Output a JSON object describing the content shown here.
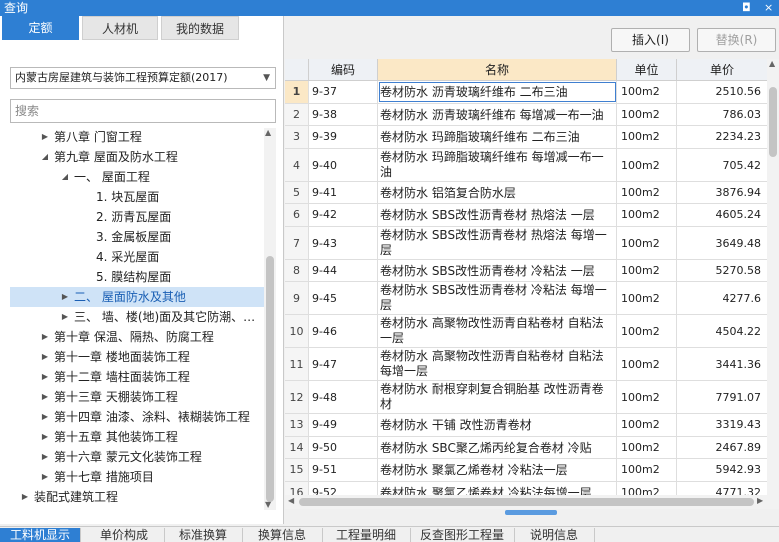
{
  "window": {
    "title": "查询",
    "controls": [
      "◘",
      "×"
    ]
  },
  "tabs": [
    {
      "label": "定额",
      "active": true
    },
    {
      "label": "人材机",
      "active": false
    },
    {
      "label": "我的数据",
      "active": false
    }
  ],
  "quota_select": {
    "value": "内蒙古房屋建筑与装饰工程预算定额(2017)"
  },
  "search": {
    "placeholder": "搜索",
    "value": ""
  },
  "tree": [
    {
      "label": "第八章 门窗工程",
      "level": 1,
      "expanded": false
    },
    {
      "label": "第九章 屋面及防水工程",
      "level": 1,
      "expanded": true
    },
    {
      "label": "一、 屋面工程",
      "level": 2,
      "expanded": true
    },
    {
      "label": "1. 块瓦屋面",
      "level": 3
    },
    {
      "label": "2. 沥青瓦屋面",
      "level": 3
    },
    {
      "label": "3. 金属板屋面",
      "level": 3
    },
    {
      "label": "4. 采光屋面",
      "level": 3
    },
    {
      "label": "5. 膜结构屋面",
      "level": 3
    },
    {
      "label": "二、 屋面防水及其他",
      "level": 2,
      "expanded": false,
      "selected": true
    },
    {
      "label": "三、 墙、楼(地)面及其它防潮、…",
      "level": 2,
      "expanded": false
    },
    {
      "label": "第十章 保温、隔热、防腐工程",
      "level": 1,
      "expanded": false
    },
    {
      "label": "第十一章 楼地面装饰工程",
      "level": 1,
      "expanded": false
    },
    {
      "label": "第十二章 墙柱面装饰工程",
      "level": 1,
      "expanded": false
    },
    {
      "label": "第十三章 天棚装饰工程",
      "level": 1,
      "expanded": false
    },
    {
      "label": "第十四章 油漆、涂料、裱糊装饰工程",
      "level": 1,
      "expanded": false
    },
    {
      "label": "第十五章 其他装饰工程",
      "level": 1,
      "expanded": false
    },
    {
      "label": "第十六章 蒙元文化装饰工程",
      "level": 1,
      "expanded": false
    },
    {
      "label": "第十七章 措施项目",
      "level": 1,
      "expanded": false
    },
    {
      "label": "装配式建筑工程",
      "level": 0,
      "expanded": false
    }
  ],
  "buttons": {
    "insert": "插入(I)",
    "replace": "替换(R)"
  },
  "table": {
    "headers": {
      "code": "编码",
      "name": "名称",
      "unit": "单位",
      "price": "单价"
    },
    "rows": [
      {
        "idx": "1",
        "code": "9-37",
        "name": "卷材防水 沥青玻璃纤维布 二布三油",
        "unit": "100m2",
        "price": "2510.56",
        "h": 2
      },
      {
        "idx": "2",
        "code": "9-38",
        "name": "卷材防水 沥青玻璃纤维布 每增减一布一油",
        "unit": "100m2",
        "price": "786.03",
        "h": 2
      },
      {
        "idx": "3",
        "code": "9-39",
        "name": "卷材防水 玛蹄脂玻璃纤维布 二布三油",
        "unit": "100m2",
        "price": "2234.23",
        "h": 2
      },
      {
        "idx": "4",
        "code": "9-40",
        "name": "卷材防水 玛蹄脂玻璃纤维布 每增减一布一油",
        "unit": "100m2",
        "price": "705.42",
        "h": 3
      },
      {
        "idx": "5",
        "code": "9-41",
        "name": "卷材防水 铝箔复合防水层",
        "unit": "100m2",
        "price": "3876.94",
        "h": 2
      },
      {
        "idx": "6",
        "code": "9-42",
        "name": "卷材防水 SBS改性沥青卷材 热熔法 一层",
        "unit": "100m2",
        "price": "4605.24",
        "h": 2
      },
      {
        "idx": "7",
        "code": "9-43",
        "name": "卷材防水 SBS改性沥青卷材 热熔法 每增一层",
        "unit": "100m2",
        "price": "3649.48",
        "h": 3
      },
      {
        "idx": "8",
        "code": "9-44",
        "name": "卷材防水 SBS改性沥青卷材 冷粘法 一层",
        "unit": "100m2",
        "price": "5270.58",
        "h": 2
      },
      {
        "idx": "9",
        "code": "9-45",
        "name": "卷材防水 SBS改性沥青卷材 冷粘法 每增一层",
        "unit": "100m2",
        "price": "4277.6",
        "h": 3
      },
      {
        "idx": "10",
        "code": "9-46",
        "name": "卷材防水 高聚物改性沥青自粘卷材 自粘法一层",
        "unit": "100m2",
        "price": "4504.22",
        "h": 3
      },
      {
        "idx": "11",
        "code": "9-47",
        "name": "卷材防水 高聚物改性沥青自粘卷材 自粘法每增一层",
        "unit": "100m2",
        "price": "3441.36",
        "h": 3
      },
      {
        "idx": "12",
        "code": "9-48",
        "name": "卷材防水 耐根穿刺复合铜胎基 改性沥青卷材",
        "unit": "100m2",
        "price": "7791.07",
        "h": 3
      },
      {
        "idx": "13",
        "code": "9-49",
        "name": "卷材防水 干铺 改性沥青卷材",
        "unit": "100m2",
        "price": "3319.43",
        "h": 2
      },
      {
        "idx": "14",
        "code": "9-50",
        "name": "卷材防水 SBC聚乙烯丙纶复合卷材 冷贴",
        "unit": "100m2",
        "price": "2467.89",
        "h": 2
      },
      {
        "idx": "15",
        "code": "9-51",
        "name": "卷材防水 聚氯乙烯卷材 冷粘法一层",
        "unit": "100m2",
        "price": "5942.93",
        "h": 2
      },
      {
        "idx": "16",
        "code": "9-52",
        "name": "卷材防水 聚氯乙烯卷材 冷粘法每增一层",
        "unit": "100m2",
        "price": "4771.32",
        "h": 2
      }
    ]
  },
  "bottom_tabs": [
    {
      "label": "工料机显示",
      "active": true
    },
    {
      "label": "单价构成",
      "active": false
    },
    {
      "label": "标准换算",
      "active": false
    },
    {
      "label": "换算信息",
      "active": false
    },
    {
      "label": "工程量明细",
      "active": false
    },
    {
      "label": "反查图形工程量",
      "active": false
    },
    {
      "label": "说明信息",
      "active": false
    }
  ]
}
